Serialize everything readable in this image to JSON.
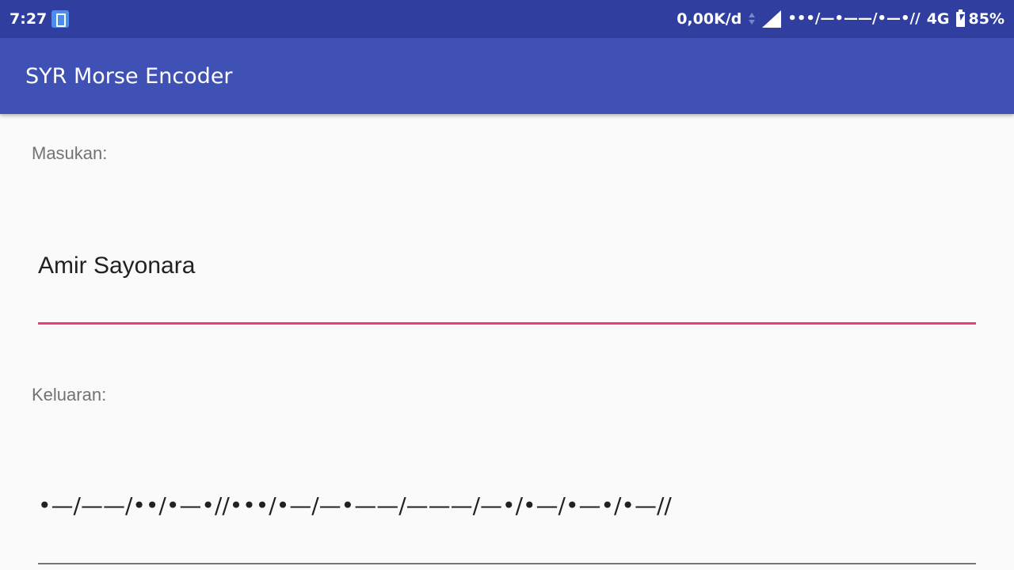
{
  "status_bar": {
    "time": "7:27",
    "network_speed": "0,00K/d",
    "morse_notification": "•••/—•——/•—•//",
    "network_type": "4G",
    "battery": "85%",
    "notification_icon": "clipboard-icon"
  },
  "app_bar": {
    "title": "SYR Morse Encoder"
  },
  "input_section": {
    "label": "Masukan:",
    "value": "Amir Sayonara",
    "accent_color": "#ec407a"
  },
  "output_section": {
    "label": "Keluaran:",
    "value": "•—/——/••/•—•//•••/•—/—•——/———/—•/•—/•—•/•—//"
  },
  "colors": {
    "status_bar": "#303f9f",
    "app_bar": "#3f51b5",
    "background": "#fafafa"
  }
}
